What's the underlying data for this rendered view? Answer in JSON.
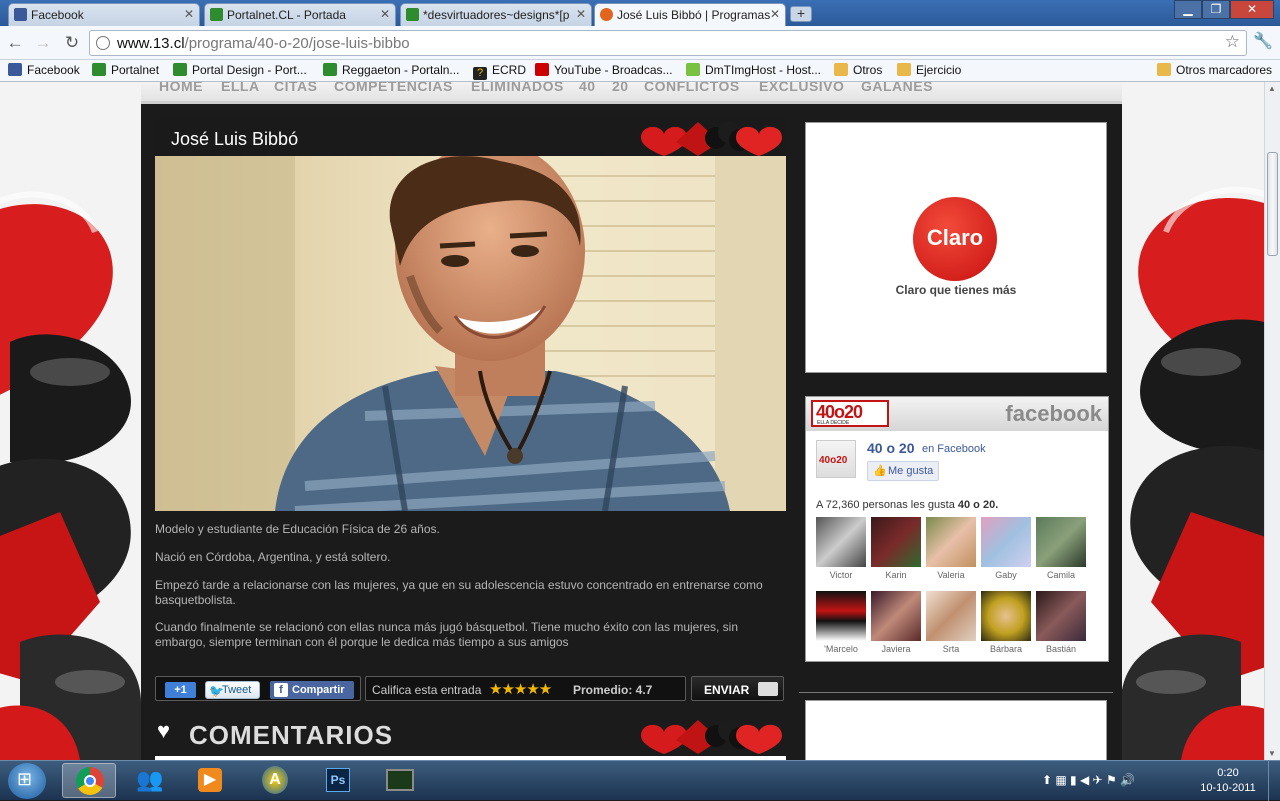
{
  "browser": {
    "tabs": [
      {
        "label": "Facebook",
        "color": "#3b5998",
        "active": false
      },
      {
        "label": "Portalnet.CL - Portada",
        "color": "#2e8b2e",
        "active": false
      },
      {
        "label": "*desvirtuadores~designs*[p",
        "color": "#2e8b2e",
        "active": false
      },
      {
        "label": "José Luis Bibbó | Programas",
        "color": "#e2651d",
        "active": true
      }
    ],
    "newtab_label": "+",
    "url_domain": "www.13.cl",
    "url_path": "/programa/40-o-20/jose-luis-bibbo",
    "bookmarks": [
      {
        "label": "Facebook",
        "color": "#3b5998"
      },
      {
        "label": "Portalnet",
        "color": "#2e8b2e"
      },
      {
        "label": "Portal Design - Port...",
        "color": "#2e8b2e"
      },
      {
        "label": "Reggaeton - Portaln...",
        "color": "#2e8b2e"
      },
      {
        "label": "ECRD",
        "color": "#222222"
      },
      {
        "label": "YouTube - Broadcas...",
        "color": "#cc0000"
      },
      {
        "label": "DmTImgHost - Host...",
        "color": "#7ac142"
      },
      {
        "label": "Otros",
        "color": "#e8b84a"
      },
      {
        "label": "Ejercicio",
        "color": "#e8b84a"
      }
    ],
    "other_bookmarks": "Otros marcadores"
  },
  "site": {
    "nav": [
      "HOME",
      "ELLA",
      "CITAS",
      "COMPETENCIAS",
      "ELIMINADOS",
      "40",
      "20",
      "CONFLICTOS",
      "EXCLUSIVO",
      "GALANES"
    ],
    "article": {
      "title": "José Luis Bibbó",
      "paragraphs": [
        "Modelo y estudiante de Educación Física de 26 años.",
        "Nació en Córdoba, Argentina, y está soltero.",
        "Empezó tarde a relacionarse con las mujeres, ya que en su adolescencia estuvo concentrado en entrenarse como basquetbolista.",
        "Cuando finalmente se relacionó con ellas nunca más jugó básquetbol. Tiene mucho éxito con las mujeres, sin embargo, siempre terminan con él porque le dedica más tiempo a sus amigos"
      ]
    },
    "share": {
      "plusone": "+1",
      "tweet": "Tweet",
      "compartir": "Compartir",
      "califica": "Califica esta entrada",
      "stars": "★★★★★",
      "promedio": "Promedio: 4.7",
      "enviar": "ENVIAR"
    },
    "comments_heading": "COMENTARIOS",
    "ad": {
      "brand": "Claro",
      "tagline": "Claro que tienes más"
    },
    "facebook_box": {
      "logo": "40o20",
      "logo_sub": "ELLA DECIDE",
      "brand": "facebook",
      "page_name": "40 o 20",
      "en_facebook": "en Facebook",
      "like": "Me gusta",
      "likes_text_prefix": "A 72,360 personas les gusta",
      "likes_name": "40 o 20.",
      "friends": [
        "Victor",
        "Karin",
        "Valeria",
        "Gaby",
        "Camila",
        "'Marcelo",
        "Javiera",
        "Srta",
        "Bárbara",
        "Bastián"
      ]
    }
  },
  "taskbar": {
    "time": "0:20",
    "date": "10-10-2011",
    "ps_label": "Ps"
  }
}
